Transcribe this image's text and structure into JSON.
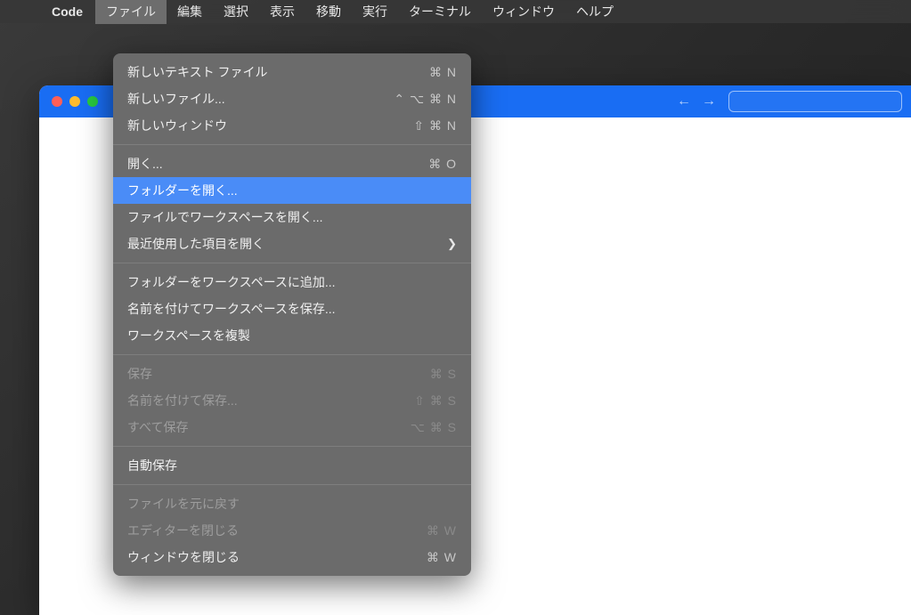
{
  "menubar": {
    "app_name": "Code",
    "items": [
      {
        "label": "ファイル",
        "active": true
      },
      {
        "label": "編集"
      },
      {
        "label": "選択"
      },
      {
        "label": "表示"
      },
      {
        "label": "移動"
      },
      {
        "label": "実行"
      },
      {
        "label": "ターミナル"
      },
      {
        "label": "ウィンドウ"
      },
      {
        "label": "ヘルプ"
      }
    ]
  },
  "dropdown": {
    "groups": [
      [
        {
          "label": "新しいテキスト ファイル",
          "shortcut": "⌘ N"
        },
        {
          "label": "新しいファイル...",
          "shortcut": "⌃ ⌥ ⌘ N"
        },
        {
          "label": "新しいウィンドウ",
          "shortcut": "⇧ ⌘ N"
        }
      ],
      [
        {
          "label": "開く...",
          "shortcut": "⌘ O"
        },
        {
          "label": "フォルダーを開く...",
          "highlighted": true
        },
        {
          "label": "ファイルでワークスペースを開く..."
        },
        {
          "label": "最近使用した項目を開く",
          "submenu": true
        }
      ],
      [
        {
          "label": "フォルダーをワークスペースに追加..."
        },
        {
          "label": "名前を付けてワークスペースを保存..."
        },
        {
          "label": "ワークスペースを複製"
        }
      ],
      [
        {
          "label": "保存",
          "shortcut": "⌘ S",
          "disabled": true
        },
        {
          "label": "名前を付けて保存...",
          "shortcut": "⇧ ⌘ S",
          "disabled": true
        },
        {
          "label": "すべて保存",
          "shortcut": "⌥ ⌘ S",
          "disabled": true
        }
      ],
      [
        {
          "label": "自動保存"
        }
      ],
      [
        {
          "label": "ファイルを元に戻す",
          "disabled": true
        },
        {
          "label": "エディターを閉じる",
          "shortcut": "⌘ W",
          "disabled": true
        },
        {
          "label": "ウィンドウを閉じる",
          "shortcut": "⌘ W"
        }
      ]
    ]
  },
  "window": {
    "colors": {
      "titlebar": "#196DF3"
    }
  }
}
